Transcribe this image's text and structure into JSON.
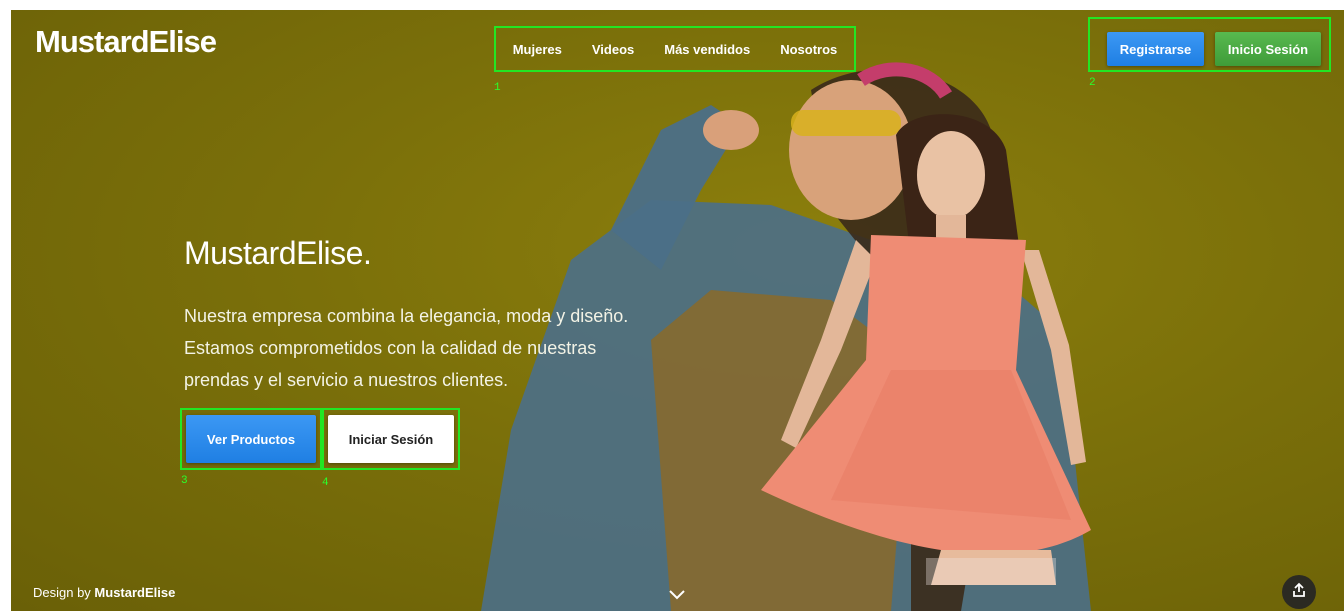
{
  "brand": {
    "logo": "MustardElise"
  },
  "nav": {
    "items": [
      {
        "label": "Mujeres"
      },
      {
        "label": "Videos"
      },
      {
        "label": "Más vendidos"
      },
      {
        "label": "Nosotros"
      }
    ]
  },
  "auth": {
    "register_label": "Registrarse",
    "login_label": "Inicio Sesión"
  },
  "hero": {
    "title": "MustardElise.",
    "description_lines": [
      "Nuestra empresa combina la elegancia, moda y diseño.",
      "Estamos comprometidos con la calidad de nuestras",
      "prendas y el servicio a nuestros clientes."
    ],
    "cta_primary": "Ver Productos",
    "cta_secondary": "Iniciar Sesión"
  },
  "annotations": {
    "a1": "1",
    "a2": "2",
    "a3": "3",
    "a4": "4"
  },
  "footer": {
    "credit_prefix": "Design by ",
    "credit_name": "MustardElise"
  },
  "icons": {
    "share": "share-icon",
    "scroll": "chevron-down-icon"
  },
  "colors": {
    "background": "#7b700a",
    "primary": "#2b8cef",
    "success": "#4caf50",
    "highlight": "#23e623"
  }
}
